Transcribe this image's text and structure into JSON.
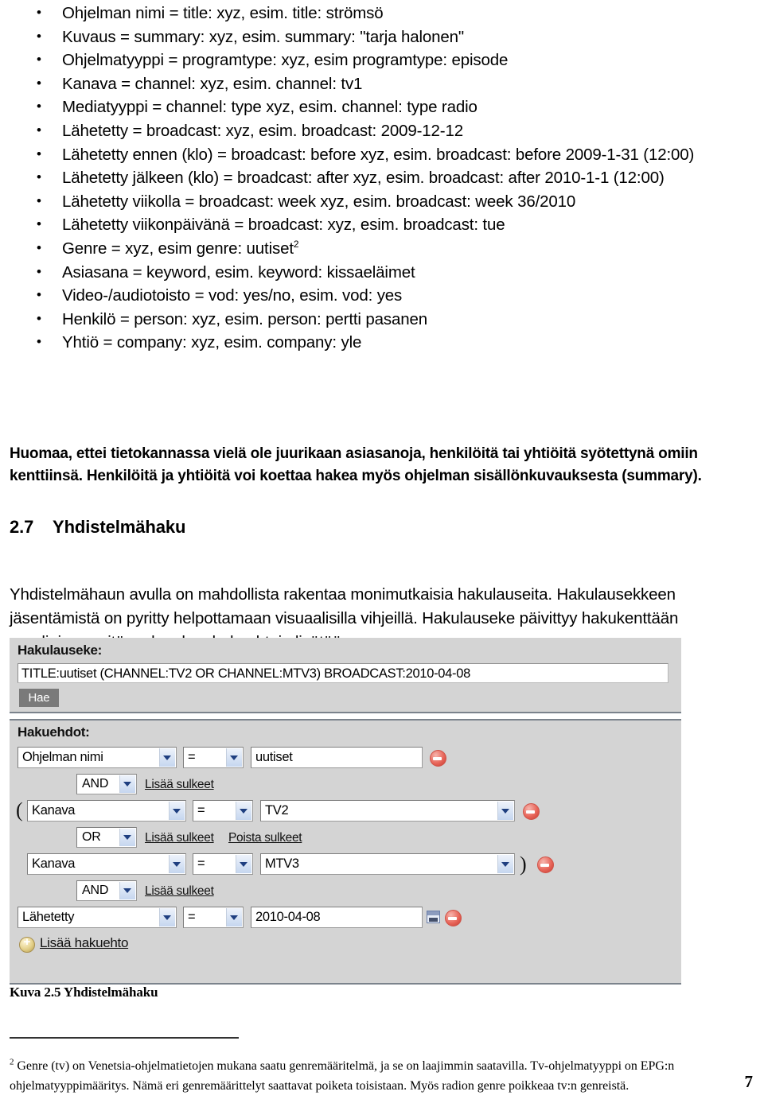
{
  "bullets": [
    "Ohjelman nimi = title: xyz, esim. title: strömsö",
    "Kuvaus = summary: xyz, esim. summary: \"tarja halonen\"",
    "Ohjelmatyyppi = programtype: xyz, esim programtype: episode",
    "Kanava = channel: xyz, esim. channel: tv1",
    "Mediatyyppi = channel: type xyz, esim. channel: type radio",
    "Lähetetty = broadcast: xyz, esim. broadcast: 2009-12-12",
    "Lähetetty ennen (klo) = broadcast: before xyz, esim. broadcast: before 2009-1-31 (12:00)",
    "Lähetetty jälkeen (klo) = broadcast: after xyz, esim. broadcast: after 2010-1-1 (12:00)",
    "Lähetetty viikolla = broadcast: week xyz, esim. broadcast: week 36/2010",
    "Lähetetty viikonpäivänä = broadcast: xyz, esim. broadcast: tue",
    "Genre = xyz, esim genre: uutiset",
    "Asiasana = keyword, esim. keyword: kissaeläimet",
    "Video-/audiotoisto = vod: yes/no, esim. vod: yes",
    "Henkilö = person: xyz, esim. person: pertti pasanen",
    "Yhtiö = company: xyz, esim. company: yle"
  ],
  "genre_footnote_marker": "2",
  "note": "Huomaa, ettei tietokannassa vielä ole juurikaan asiasanoja, henkilöitä tai yhtiöitä syötettynä omiin kenttiinsä. Henkilöitä ja yhtiöitä voi koettaa hakea myös ohjelman sisällönkuvauksesta (summary).",
  "heading": {
    "number": "2.7",
    "title": "Yhdistelmähaku"
  },
  "body_paragraph": "Yhdistelmähaun avulla on mahdollista rakentaa monimutkaisia hakulauseita. Hakulausekkeen jäsentämistä on pyritty helpottamaan visuaalisilla vihjeillä. Hakulauseke päivittyy hakukenttään reaaliajassa sitä mukaa kun hakuehtoja lisätään.",
  "screenshot": {
    "expression_label": "Hakulauseke:",
    "expression_value": "TITLE:uutiset (CHANNEL:TV2 OR CHANNEL:MTV3) BROADCAST:2010-04-08",
    "search_button": "Hae",
    "conditions_label": "Hakuehdot:",
    "rows": [
      {
        "field": "Ohjelman nimi",
        "operator": "=",
        "value": "uutiset",
        "value_kind": "text",
        "open_paren": "",
        "close_paren": ""
      },
      {
        "field": "Kanava",
        "operator": "=",
        "value": "TV2",
        "value_kind": "select",
        "open_paren": "(",
        "close_paren": ""
      },
      {
        "field": "Kanava",
        "operator": "=",
        "value": "MTV3",
        "value_kind": "select",
        "open_paren": "",
        "close_paren": ")"
      },
      {
        "field": "Lähetetty",
        "operator": "=",
        "value": "2010-04-08",
        "value_kind": "date",
        "open_paren": "",
        "close_paren": ""
      }
    ],
    "connectors": [
      {
        "logic": "AND",
        "links": [
          "Lisää sulkeet"
        ]
      },
      {
        "logic": "OR",
        "links": [
          "Lisää sulkeet",
          "Poista sulkeet"
        ]
      },
      {
        "logic": "AND",
        "links": [
          "Lisää sulkeet"
        ]
      }
    ],
    "add_condition_link": "Lisää hakuehto"
  },
  "caption": "Kuva 2.5 Yhdistelmähaku",
  "footnote": {
    "marker": "2",
    "text": "Genre (tv) on Venetsia-ohjelmatietojen mukana saatu genremääritelmä, ja se on laajimmin saatavilla. Tv-ohjelmatyyppi on EPG:n ohjelmatyyppimääritys. Nämä eri genremäärittelyt saattavat poiketa toisistaan. Myös radion genre poikkeaa tv:n genreistä."
  },
  "page_number": "7"
}
